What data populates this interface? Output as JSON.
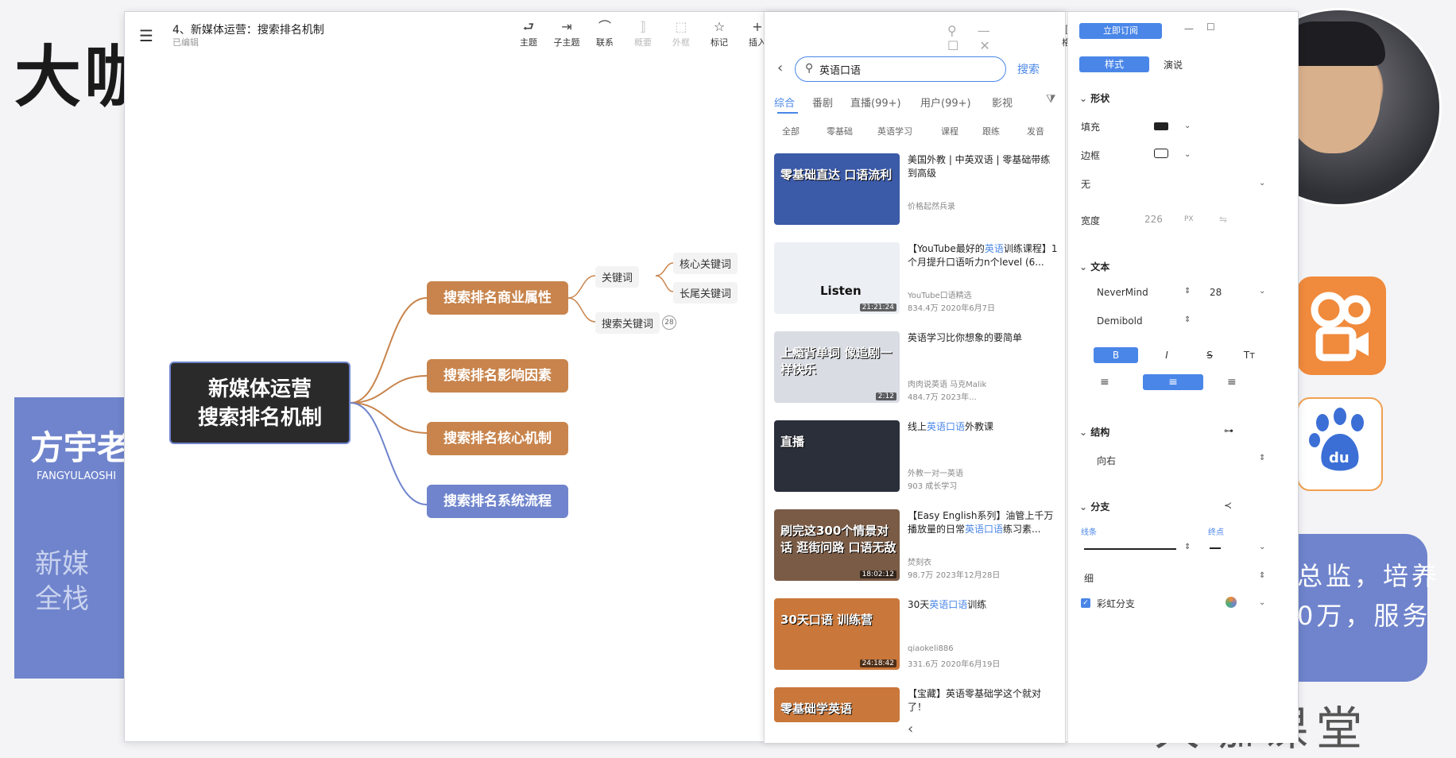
{
  "background": {
    "big_logo": "大咖",
    "teacher_name": "方宇老",
    "teacher_pinyin": "FANGYULAOSHI",
    "teacher_tag": "新媒全栈",
    "right_text_1": "总监，培养",
    "right_text_2": "0万，服务",
    "brand": "大咖课堂"
  },
  "app": {
    "title": "4、新媒体运营：搜索排名机制",
    "status": "已编辑",
    "toolbar": [
      {
        "icon": "topic-icon",
        "glyph": "⮐",
        "label": "主题",
        "enabled": true
      },
      {
        "icon": "subtopic-icon",
        "glyph": "⇥",
        "label": "子主题",
        "enabled": true
      },
      {
        "icon": "relation-icon",
        "glyph": "⌒",
        "label": "联系",
        "enabled": true
      },
      {
        "icon": "summary-icon",
        "glyph": "⟧",
        "label": "概要",
        "enabled": false
      },
      {
        "icon": "boundary-icon",
        "glyph": "⬚",
        "label": "外框",
        "enabled": false
      },
      {
        "icon": "mark-icon",
        "glyph": "☆",
        "label": "标记",
        "enabled": true
      },
      {
        "icon": "insert-icon",
        "glyph": "+",
        "label": "插入",
        "enabled": true
      }
    ],
    "format_label": "格式"
  },
  "mindmap": {
    "root": [
      "新媒体运营",
      "搜索排名机制"
    ],
    "branches": [
      {
        "label": "搜索排名商业属性",
        "color": "#c8844c"
      },
      {
        "label": "搜索排名影响因素",
        "color": "#c8844c"
      },
      {
        "label": "搜索排名核心机制",
        "color": "#c8844c"
      },
      {
        "label": "搜索排名系统流程",
        "color": "#6f84cc"
      }
    ],
    "sub_keyword": "关键词",
    "sub_search_keyword": "搜索关键词",
    "sub_search_keyword_badge": "28",
    "leaf_core": "核心关键词",
    "leaf_longtail": "长尾关键词"
  },
  "search": {
    "query": "英语口语",
    "button": "搜索",
    "tabs": [
      "综合",
      "番剧",
      "直播(99+)",
      "用户(99+)",
      "影视"
    ],
    "active_tab": "综合",
    "filters": [
      "全部",
      "零基础",
      "英语学习",
      "课程",
      "跟练",
      "发音"
    ],
    "results": [
      {
        "thumb_caption": "零基础直达 口语流利",
        "thumb_color": "#3b5aa8",
        "duration": "",
        "title_pre": "美国外教 | 中英双语 | 零基础带练到高级",
        "title_hl": "",
        "title_post": "",
        "meta1": "价格起然兵录",
        "meta2": ""
      },
      {
        "thumb_caption": "Listen",
        "thumb_color": "#eceff4",
        "duration": "21:21:24",
        "title_pre": "【YouTube最好的",
        "title_hl": "英语",
        "title_post": "训练课程】1个月提升口语听力n个level (6...",
        "meta1": "YouTube口语精选",
        "meta2": "834.4万  2020年6月7日"
      },
      {
        "thumb_caption": "上瘾背单词 像追剧一样快乐",
        "thumb_color": "#d9dce3",
        "duration": "2:12",
        "title_pre": "英语学习比你想象的要简单",
        "title_hl": "",
        "title_post": "",
        "meta1": "肉肉说英语  马克Malik",
        "meta2": "484.7万  2023年..."
      },
      {
        "thumb_caption": "直播",
        "thumb_color": "#2b2f3a",
        "duration": "",
        "title_pre": "线上",
        "title_hl": "英语口语",
        "title_post": "外教课",
        "meta1": "外教一对一英语",
        "meta2": "903  成长学习"
      },
      {
        "thumb_caption": "刷完这300个情景对话 逛街问路 口语无敌",
        "thumb_color": "#7a5b45",
        "duration": "18:02:12",
        "title_pre": "【Easy English系列】油管上千万播放量的日常",
        "title_hl": "英语口语",
        "title_post": "练习素...",
        "meta1": "焚刻衣",
        "meta2": "98.7万  2023年12月28日"
      },
      {
        "thumb_caption": "30天口语 训练营",
        "thumb_color": "#c9773a",
        "duration": "24:18:42",
        "title_pre": "30天",
        "title_hl": "英语口语",
        "title_post": "训练",
        "meta1": "qiaokeli886",
        "meta2": "331.6万  2020年6月19日"
      },
      {
        "thumb_caption": "零基础学英语",
        "thumb_color": "#c9773a",
        "duration": "",
        "title_pre": "【宝藏】英语零基础学这个就对了！",
        "title_hl": "",
        "title_post": "",
        "meta1": "",
        "meta2": ""
      }
    ]
  },
  "props": {
    "subscribe": "立即订阅",
    "tab_style": "样式",
    "tab_preview": "演说",
    "shape_section": "形状",
    "fill_label": "填充",
    "border_label": "边框",
    "none_label": "无",
    "width_label": "宽度",
    "width_value": "226",
    "width_unit": "PX",
    "text_section": "文本",
    "font_name": "NeverMind",
    "font_size": "28",
    "font_weight": "Demibold",
    "bold": "B",
    "italic": "I",
    "strike": "S",
    "case": "Tт",
    "structure_section": "结构",
    "structure_value": "向右",
    "branch_section": "分支",
    "line_label": "线条",
    "end_label": "终点",
    "thin_label": "细",
    "rainbow_label": "彩虹分支"
  }
}
